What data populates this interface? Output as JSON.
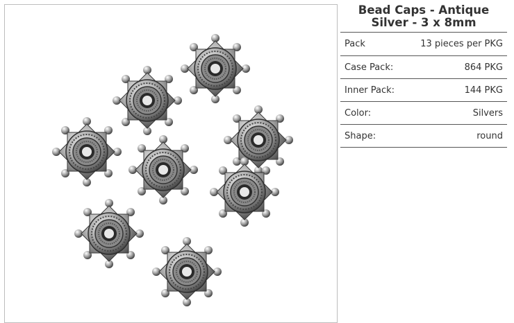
{
  "product": {
    "title_line1": "Bead Caps - Antique",
    "title_line2": "Silver - 3 x 8mm",
    "image_alt": "Bead caps antique silver"
  },
  "specs": [
    {
      "label": "Pack",
      "value": "13 pieces per PKG"
    },
    {
      "label": "Case Pack:",
      "value": "864 PKG"
    },
    {
      "label": "Inner Pack:",
      "value": "144 PKG"
    },
    {
      "label": "Color:",
      "value": "Silvers"
    },
    {
      "label": "Shape:",
      "value": "round"
    }
  ]
}
